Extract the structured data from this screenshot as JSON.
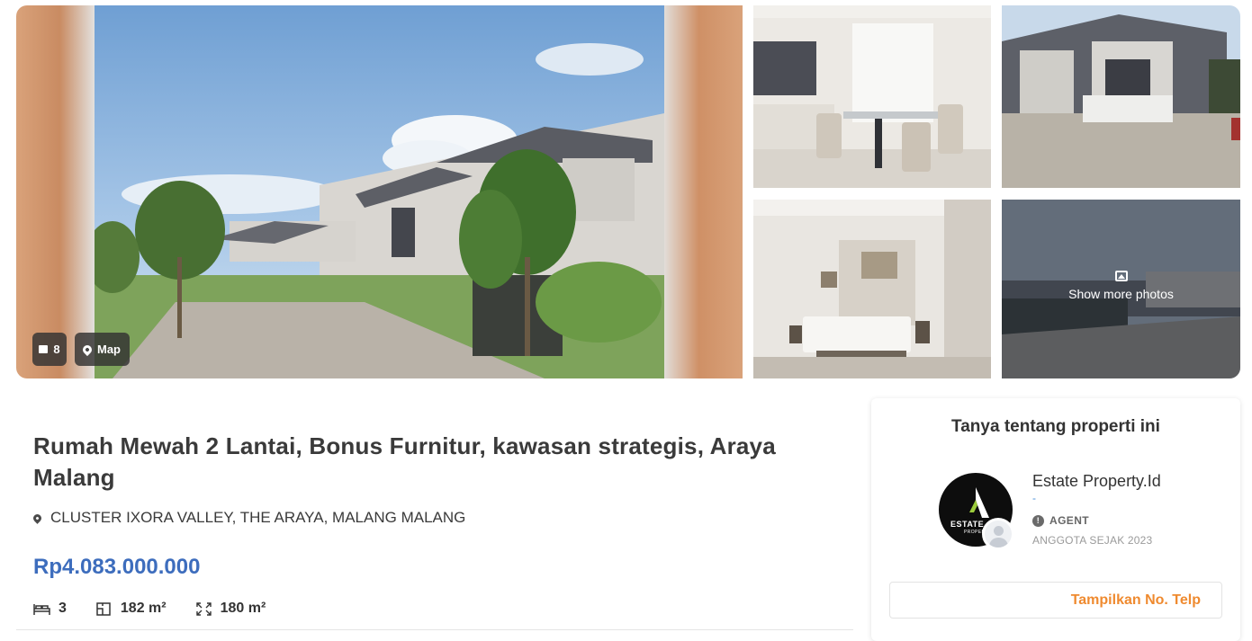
{
  "gallery": {
    "photo_count": "8",
    "map_label": "Map",
    "show_more_label": "Show more photos"
  },
  "listing": {
    "title": "Rumah Mewah 2 Lantai, Bonus Furnitur, kawasan strategis, Araya Malang",
    "address": "CLUSTER IXORA VALLEY, THE ARAYA, MALANG MALANG",
    "price": "Rp4.083.000.000",
    "bedrooms": "3",
    "building_area": "182 m²",
    "land_area": "180 m²"
  },
  "agent_card": {
    "heading": "Tanya tentang properti ini",
    "agent_name": "Estate Property.Id",
    "agent_sub": "-",
    "role": "AGENT",
    "member_since": "ANGGOTA SEJAK 2023",
    "logo_text": "ESTATE",
    "logo_subtext": "PROPERTY",
    "phone_button_label": "Tampilkan No. Telp"
  },
  "colors": {
    "price": "#3d6dbd",
    "phone_button": "#ef8a2f",
    "gradient_side": "#d9a27a"
  },
  "icons": {
    "photos": "image-icon",
    "map": "map-pin-icon",
    "address": "location-pin-icon",
    "bed": "bed-icon",
    "building": "floor-area-icon",
    "land": "land-area-icon",
    "info": "info-icon"
  }
}
